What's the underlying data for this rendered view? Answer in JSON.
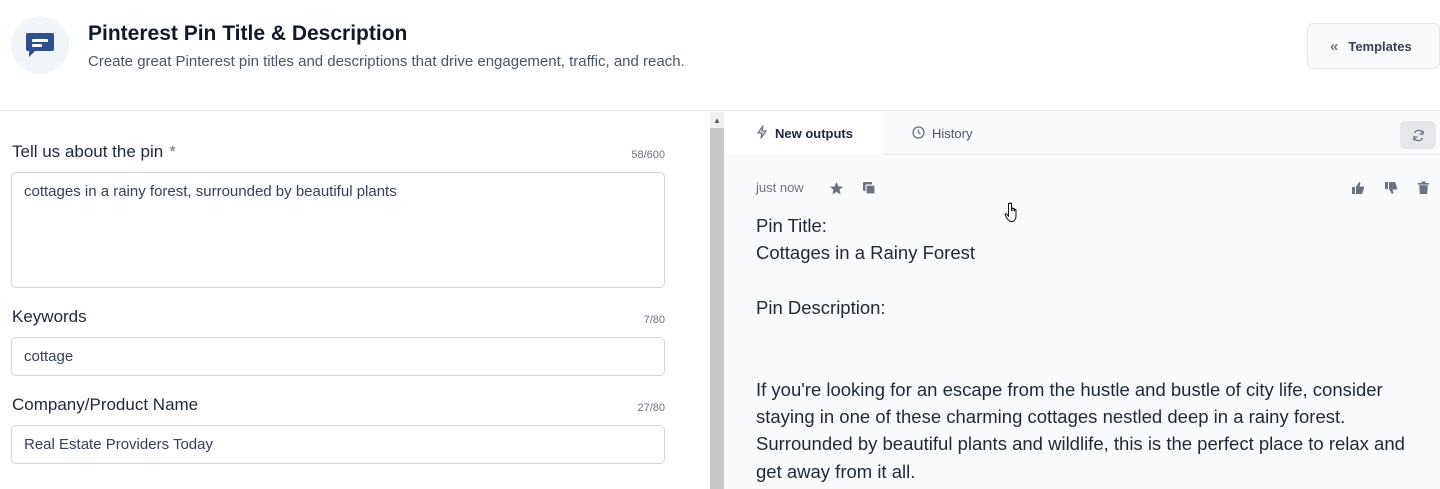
{
  "header": {
    "title": "Pinterest Pin Title & Description",
    "subtitle": "Create great Pinterest pin titles and descriptions that drive engagement, traffic, and reach.",
    "templates_label": "Templates",
    "app_icon": "chat-icon"
  },
  "form": {
    "pin": {
      "label": "Tell us about the pin",
      "required_mark": "*",
      "counter": "58/600",
      "value": "cottages in a rainy forest, surrounded by beautiful plants"
    },
    "keywords": {
      "label": "Keywords",
      "counter": "7/80",
      "value": "cottage"
    },
    "company": {
      "label": "Company/Product Name",
      "counter": "27/80",
      "value": "Real Estate Providers Today"
    }
  },
  "tabs": {
    "new_outputs": "New outputs",
    "history": "History"
  },
  "output": {
    "timestamp": "just now",
    "text": "Pin Title:\nCottages in a Rainy Forest\n\nPin Description:\n\n\nIf you're looking for an escape from the hustle and bustle of city life, consider staying in one of these charming cottages nestled deep in a rainy forest. Surrounded by beautiful plants and wildlife, this is the perfect place to relax and get away from it all."
  },
  "colors": {
    "brand": "#334e8c",
    "accent_bg": "#f1f5f9"
  }
}
